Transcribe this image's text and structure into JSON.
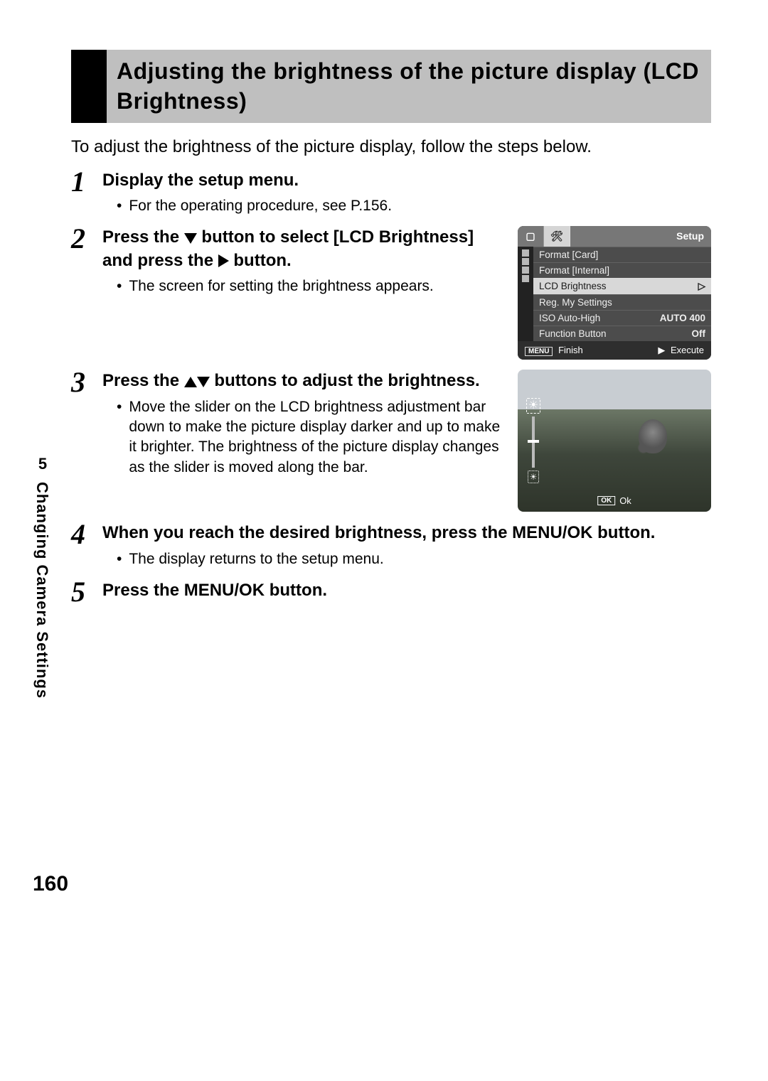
{
  "chapter_number": "5",
  "chapter_title": "Changing Camera Settings",
  "page_number": "160",
  "header_title": "Adjusting the brightness of the picture display (LCD Brightness)",
  "intro": "To adjust the brightness of the picture display, follow the steps below.",
  "steps": [
    {
      "num": "1",
      "title": "Display the setup menu.",
      "bullets": [
        "For the operating procedure, see P.156."
      ]
    },
    {
      "num": "2",
      "title_parts": {
        "p1": "Press the ",
        "p2": " button to select [LCD Brightness] and press the ",
        "p3": " button."
      },
      "bullets": [
        "The screen for setting the brightness appears."
      ]
    },
    {
      "num": "3",
      "title_parts": {
        "p1": "Press the ",
        "p2": " buttons to adjust the brightness."
      },
      "bullets": [
        "Move the slider on the LCD brightness adjustment bar down to make the picture display darker and up to make it brighter. The brightness of the picture display changes as the slider is moved along the bar."
      ]
    },
    {
      "num": "4",
      "title": "When you reach the desired brightness, press the MENU/OK button.",
      "bullets": [
        "The display returns to the setup menu."
      ]
    },
    {
      "num": "5",
      "title": "Press the MENU/OK button."
    }
  ],
  "setup_menu": {
    "tab_label": "Setup",
    "rows": [
      {
        "label": "Format [Card]",
        "value": ""
      },
      {
        "label": "Format [Internal]",
        "value": ""
      },
      {
        "label": "LCD Brightness",
        "value": "▷",
        "selected": true
      },
      {
        "label": "Reg. My Settings",
        "value": ""
      },
      {
        "label": "ISO Auto-High",
        "value": "AUTO 400"
      },
      {
        "label": "Function Button",
        "value": "Off"
      }
    ],
    "footer": {
      "menu_label": "MENU",
      "finish": "Finish",
      "execute": "Execute"
    }
  },
  "brightness_screen": {
    "ok_box": "OK",
    "ok_label": "Ok"
  }
}
